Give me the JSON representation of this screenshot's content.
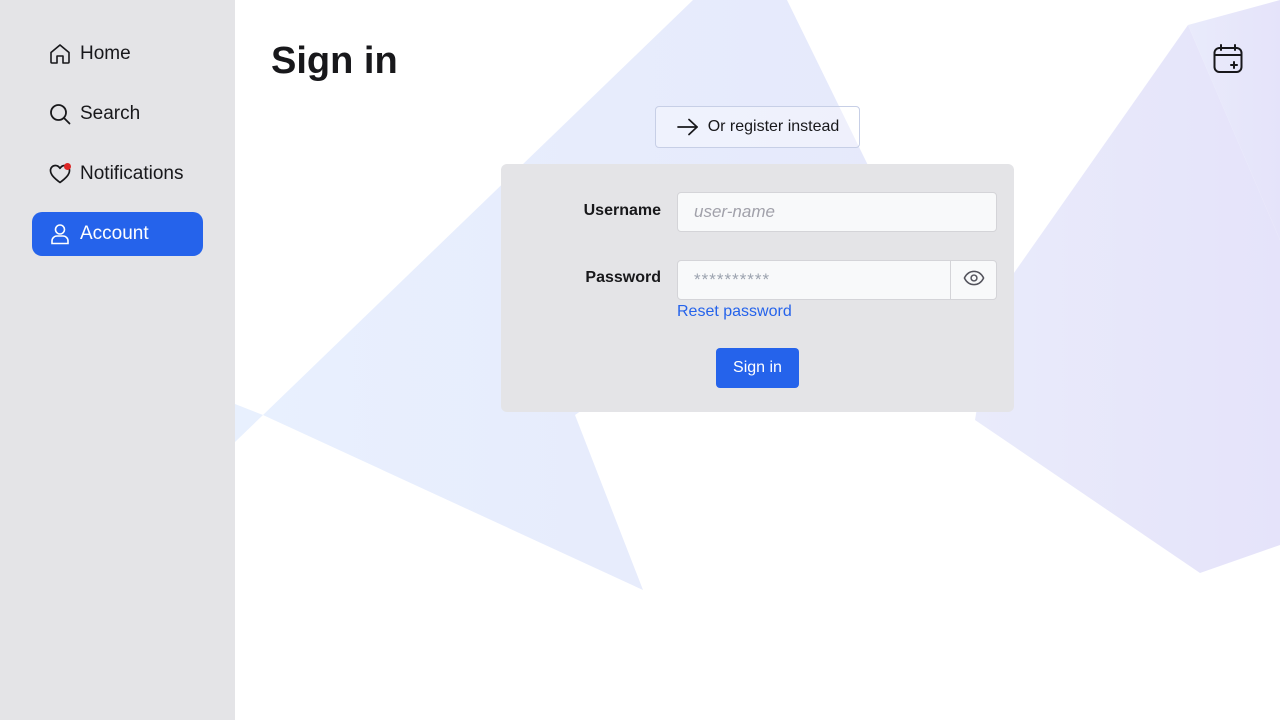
{
  "sidebar": {
    "items": [
      {
        "label": "Home",
        "icon": "home-icon",
        "active": false
      },
      {
        "label": "Search",
        "icon": "search-icon",
        "active": false
      },
      {
        "label": "Notifications",
        "icon": "heart-icon",
        "active": false,
        "has_badge": true
      },
      {
        "label": "Account",
        "icon": "user-icon",
        "active": true
      }
    ]
  },
  "header": {
    "title": "Sign in",
    "action_icon": "calendar-plus-icon"
  },
  "register": {
    "label": "Or register instead",
    "icon": "arrow-right-icon"
  },
  "form": {
    "username_label": "Username",
    "username_placeholder": "user-name",
    "username_value": "",
    "password_label": "Password",
    "password_placeholder": "**********",
    "password_value": "",
    "toggle_icon": "eye-icon",
    "reset_label": "Reset password",
    "submit_label": "Sign in"
  },
  "colors": {
    "accent": "#2563eb",
    "sidebar_bg": "#e4e4e7",
    "card_bg": "#e4e4e7",
    "badge": "#dc2626"
  }
}
